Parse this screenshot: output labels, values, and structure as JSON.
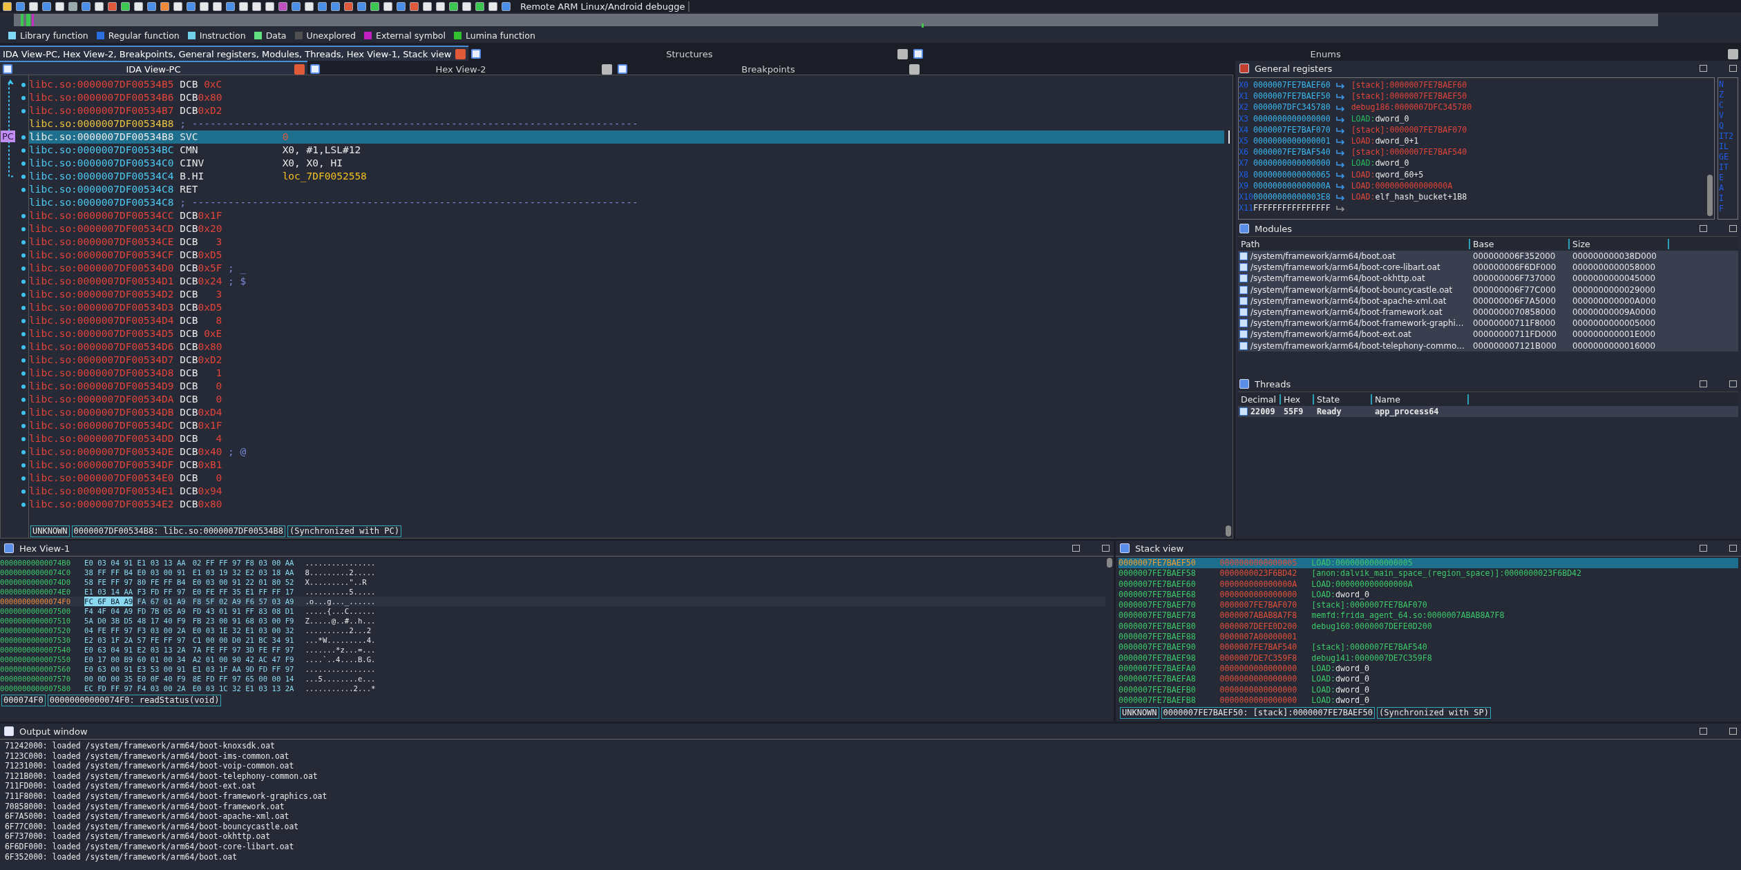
{
  "toolbar": {
    "debugger_name": "Remote ARM Linux/Android debugge"
  },
  "legend": [
    {
      "label": "Library function",
      "color": "#80d8f8"
    },
    {
      "label": "Regular function",
      "color": "#2a6fe0"
    },
    {
      "label": "Instruction",
      "color": "#70d0e8"
    },
    {
      "label": "Data",
      "color": "#60e080"
    },
    {
      "label": "Unexplored",
      "color": "#505050"
    },
    {
      "label": "External symbol",
      "color": "#c020c0"
    },
    {
      "label": "Lumina function",
      "color": "#30c030"
    }
  ],
  "main_tabs": [
    {
      "label": "IDA View-PC, Hex View-2, Breakpoints, General registers, Modules, Threads, Hex View-1, Stack view",
      "selected": true
    },
    {
      "label": "Structures",
      "selected": false
    },
    {
      "label": "Enums",
      "selected": false
    }
  ],
  "view_tabs": [
    {
      "label": "IDA View-PC",
      "selected": true
    },
    {
      "label": "Hex View-2",
      "selected": false
    },
    {
      "label": "Breakpoints",
      "selected": false
    }
  ],
  "disassembly": {
    "pc_marker": "PC",
    "lines": [
      {
        "kind": "data",
        "address": "libc.so:0000007DF00534B5",
        "mnemonic": "DCB",
        "operand": "0xC",
        "selected": false
      },
      {
        "kind": "data",
        "address": "libc.so:0000007DF00534B6",
        "mnemonic": "DCB",
        "operand": "0x80",
        "selected": false
      },
      {
        "kind": "data",
        "address": "libc.so:0000007DF00534B7",
        "mnemonic": "DCB",
        "operand": "0xD2",
        "selected": false
      },
      {
        "kind": "separator",
        "address": "libc.so:0000007DF00534B8",
        "comment": "; --------------------------------------------------------------------------",
        "selected": false
      },
      {
        "kind": "code",
        "address": "libc.so:0000007DF00534B8",
        "mnemonic": "SVC",
        "operand": "0",
        "operand_is_number": true,
        "operand_is_label": false,
        "selected": true
      },
      {
        "kind": "code",
        "address": "libc.so:0000007DF00534BC",
        "mnemonic": "CMN",
        "operand": "X0, #1,LSL#12",
        "operand_is_number": false,
        "operand_is_label": false,
        "selected": false
      },
      {
        "kind": "code",
        "address": "libc.so:0000007DF00534C0",
        "mnemonic": "CINV",
        "operand": "X0, X0, HI",
        "operand_is_number": false,
        "operand_is_label": false,
        "selected": false
      },
      {
        "kind": "code",
        "address": "libc.so:0000007DF00534C4",
        "mnemonic": "B.HI",
        "operand": "loc_7DF0052558",
        "operand_is_number": false,
        "operand_is_label": true,
        "selected": false
      },
      {
        "kind": "code",
        "address": "libc.so:0000007DF00534C8",
        "mnemonic": "RET",
        "selected": false
      },
      {
        "kind": "separator",
        "address": "libc.so:0000007DF00534C8",
        "comment": "; --------------------------------------------------------------------------",
        "selected": false
      },
      {
        "kind": "data",
        "address": "libc.so:0000007DF00534CC",
        "mnemonic": "DCB",
        "operand": "0x1F",
        "selected": false
      },
      {
        "kind": "data",
        "address": "libc.so:0000007DF00534CD",
        "mnemonic": "DCB",
        "operand": "0x20",
        "selected": false
      },
      {
        "kind": "data",
        "address": "libc.so:0000007DF00534CE",
        "mnemonic": "DCB",
        "operand": "3",
        "selected": false
      },
      {
        "kind": "data",
        "address": "libc.so:0000007DF00534CF",
        "mnemonic": "DCB",
        "operand": "0xD5",
        "selected": false
      },
      {
        "kind": "data",
        "address": "libc.so:0000007DF00534D0",
        "mnemonic": "DCB",
        "operand": "0x5F",
        "comment": "; _",
        "selected": false
      },
      {
        "kind": "data",
        "address": "libc.so:0000007DF00534D1",
        "mnemonic": "DCB",
        "operand": "0x24",
        "comment": "; $",
        "selected": false
      },
      {
        "kind": "data",
        "address": "libc.so:0000007DF00534D2",
        "mnemonic": "DCB",
        "operand": "3",
        "selected": false
      },
      {
        "kind": "data",
        "address": "libc.so:0000007DF00534D3",
        "mnemonic": "DCB",
        "operand": "0xD5",
        "selected": false
      },
      {
        "kind": "data",
        "address": "libc.so:0000007DF00534D4",
        "mnemonic": "DCB",
        "operand": "8",
        "selected": false
      },
      {
        "kind": "data",
        "address": "libc.so:0000007DF00534D5",
        "mnemonic": "DCB",
        "operand": "0xE",
        "selected": false
      },
      {
        "kind": "data",
        "address": "libc.so:0000007DF00534D6",
        "mnemonic": "DCB",
        "operand": "0x80",
        "selected": false
      },
      {
        "kind": "data",
        "address": "libc.so:0000007DF00534D7",
        "mnemonic": "DCB",
        "operand": "0xD2",
        "selected": false
      },
      {
        "kind": "data",
        "address": "libc.so:0000007DF00534D8",
        "mnemonic": "DCB",
        "operand": "1",
        "selected": false
      },
      {
        "kind": "data",
        "address": "libc.so:0000007DF00534D9",
        "mnemonic": "DCB",
        "operand": "0",
        "selected": false
      },
      {
        "kind": "data",
        "address": "libc.so:0000007DF00534DA",
        "mnemonic": "DCB",
        "operand": "0",
        "selected": false
      },
      {
        "kind": "data",
        "address": "libc.so:0000007DF00534DB",
        "mnemonic": "DCB",
        "operand": "0xD4",
        "selected": false
      },
      {
        "kind": "data",
        "address": "libc.so:0000007DF00534DC",
        "mnemonic": "DCB",
        "operand": "0x1F",
        "selected": false
      },
      {
        "kind": "data",
        "address": "libc.so:0000007DF00534DD",
        "mnemonic": "DCB",
        "operand": "4",
        "selected": false
      },
      {
        "kind": "data",
        "address": "libc.so:0000007DF00534DE",
        "mnemonic": "DCB",
        "operand": "0x40",
        "comment": "; @",
        "selected": false
      },
      {
        "kind": "data",
        "address": "libc.so:0000007DF00534DF",
        "mnemonic": "DCB",
        "operand": "0xB1",
        "selected": false
      },
      {
        "kind": "data",
        "address": "libc.so:0000007DF00534E0",
        "mnemonic": "DCB",
        "operand": "0",
        "selected": false
      },
      {
        "kind": "data",
        "address": "libc.so:0000007DF00534E1",
        "mnemonic": "DCB",
        "operand": "0x94",
        "selected": false
      },
      {
        "kind": "data",
        "address": "libc.so:0000007DF00534E2",
        "mnemonic": "DCB",
        "operand": "0x80",
        "selected": false
      }
    ],
    "status": [
      "UNKNOWN",
      "0000007DF00534B8: libc.so:0000007DF00534B8",
      "(Synchronized with PC)"
    ]
  },
  "registers": {
    "title": "General registers",
    "rows": [
      {
        "name": "X0",
        "value": "0000007FE7BAEF60",
        "valid_pointer": true,
        "segment": "[stack]:",
        "code_segment": false,
        "symbol": "0000007FE7BAEF60",
        "named_symbol": false
      },
      {
        "name": "X1",
        "value": "0000007FE7BAEF50",
        "valid_pointer": true,
        "segment": "[stack]:",
        "code_segment": false,
        "symbol": "0000007FE7BAEF50",
        "named_symbol": false
      },
      {
        "name": "X2",
        "value": "0000007DFC345780",
        "valid_pointer": true,
        "segment": "debug186:",
        "code_segment": false,
        "symbol": "0000007DFC345780",
        "named_symbol": false
      },
      {
        "name": "X3",
        "value": "0000000000000000",
        "valid_pointer": true,
        "segment": "LOAD:",
        "code_segment": true,
        "symbol": "dword_0",
        "named_symbol": true
      },
      {
        "name": "X4",
        "value": "0000007FE7BAF070",
        "valid_pointer": true,
        "segment": "[stack]:",
        "code_segment": false,
        "symbol": "0000007FE7BAF070",
        "named_symbol": false
      },
      {
        "name": "X5",
        "value": "0000000000000001",
        "valid_pointer": true,
        "segment": "LOAD:",
        "code_segment": false,
        "symbol": "dword_0+1",
        "named_symbol": true
      },
      {
        "name": "X6",
        "value": "0000007FE7BAF540",
        "valid_pointer": true,
        "segment": "[stack]:",
        "code_segment": false,
        "symbol": "0000007FE7BAF540",
        "named_symbol": false
      },
      {
        "name": "X7",
        "value": "0000000000000000",
        "valid_pointer": true,
        "segment": "LOAD:",
        "code_segment": true,
        "symbol": "dword_0",
        "named_symbol": true
      },
      {
        "name": "X8",
        "value": "0000000000000065",
        "valid_pointer": true,
        "segment": "LOAD:",
        "code_segment": false,
        "symbol": "qword_60+5",
        "named_symbol": true
      },
      {
        "name": "X9",
        "value": "000000000000000A",
        "valid_pointer": true,
        "segment": "LOAD:",
        "code_segment": false,
        "symbol": "000000000000000A",
        "named_symbol": false
      },
      {
        "name": "X10",
        "value": "00000000000003E8",
        "valid_pointer": true,
        "segment": "LOAD:",
        "code_segment": false,
        "symbol": "elf_hash_bucket+1B8",
        "named_symbol": true
      },
      {
        "name": "X11",
        "value": "FFFFFFFFFFFFFFFF",
        "valid_pointer": false
      }
    ],
    "flags": [
      "N",
      "Z",
      "C",
      "V",
      "Q",
      "IT2",
      "IL",
      "GE",
      "IT",
      "E",
      "A",
      "I",
      "F"
    ]
  },
  "modules": {
    "title": "Modules",
    "columns": [
      "Path",
      "Base",
      "Size"
    ],
    "rows": [
      {
        "path": "/system/framework/arm64/boot.oat",
        "base": "000000006F352000",
        "size": "000000000038D000"
      },
      {
        "path": "/system/framework/arm64/boot-core-libart.oat",
        "base": "000000006F6DF000",
        "size": "0000000000058000"
      },
      {
        "path": "/system/framework/arm64/boot-okhttp.oat",
        "base": "000000006F737000",
        "size": "0000000000045000"
      },
      {
        "path": "/system/framework/arm64/boot-bouncycastle.oat",
        "base": "000000006F77C000",
        "size": "0000000000029000"
      },
      {
        "path": "/system/framework/arm64/boot-apache-xml.oat",
        "base": "000000006F7A5000",
        "size": "000000000000A000"
      },
      {
        "path": "/system/framework/arm64/boot-framework.oat",
        "base": "0000000070858000",
        "size": "00000000009A0000"
      },
      {
        "path": "/system/framework/arm64/boot-framework-graphi…",
        "base": "00000000711F8000",
        "size": "0000000000005000"
      },
      {
        "path": "/system/framework/arm64/boot-ext.oat",
        "base": "00000000711FD000",
        "size": "000000000001E000"
      },
      {
        "path": "/system/framework/arm64/boot-telephony-commo…",
        "base": "000000007121B000",
        "size": "0000000000016000"
      }
    ]
  },
  "threads": {
    "title": "Threads",
    "columns": [
      "Decimal",
      "Hex",
      "State",
      "Name"
    ],
    "rows": [
      {
        "decimal": "22009",
        "hex": "55F9",
        "state": "Ready",
        "name": "app_process64"
      }
    ]
  },
  "hex_view": {
    "title": "Hex View-1",
    "rows": [
      {
        "address": "00000000000074B0",
        "bytes_left": "E0 03 04 91 E1 03 13 AA",
        "bytes_right": "02 FF FF 97 F8 03 00 AA",
        "ascii": "................",
        "current": false
      },
      {
        "address": "00000000000074C0",
        "bytes_left": "38 FF FF B4 E0 03 00 91",
        "bytes_right": "E1 03 19 32 E2 03 18 AA",
        "ascii": "8.........2.....",
        "current": false
      },
      {
        "address": "00000000000074D0",
        "bytes_left": "58 FE FF 97 80 FE FF B4",
        "bytes_right": "E0 03 00 91 22 01 80 52",
        "ascii": "X.........\"..R",
        "current": false
      },
      {
        "address": "00000000000074E0",
        "bytes_left": "E1 03 14 AA F3 FD FF 97",
        "bytes_right": "E0 FE FF 35 E1 FF FF 17",
        "ascii": "..........5.....",
        "current": false
      },
      {
        "address": "00000000000074F0",
        "selection": "FC 6F BA A9",
        "bytes_left": "FA 67 01 A9",
        "bytes_right": "F8 5F 02 A9 F6 57 03 A9",
        "ascii": ".o...g..._......",
        "current": true
      },
      {
        "address": "0000000000007500",
        "bytes_left": "F4 4F 04 A9 FD 7B 05 A9",
        "bytes_right": "FD 43 01 91 FF 83 08 D1",
        "ascii": ".....{...C......",
        "current": false
      },
      {
        "address": "0000000000007510",
        "bytes_left": "5A D0 3B D5 48 17 40 F9",
        "bytes_right": "FB 23 00 91 68 03 00 F9",
        "ascii": "Z.....@..#..h...",
        "current": false
      },
      {
        "address": "0000000000007520",
        "bytes_left": "04 FE FF 97 F3 03 00 2A",
        "bytes_right": "E0 03 1E 32 E1 03 00 32",
        "ascii": "..........2...2",
        "current": false
      },
      {
        "address": "0000000000007530",
        "bytes_left": "E2 03 1F 2A 57 FE FF 97",
        "bytes_right": "C1 00 00 D0 21 BC 34 91",
        "ascii": "...*W.........4.",
        "current": false
      },
      {
        "address": "0000000000007540",
        "bytes_left": "E0 63 04 91 E2 03 13 2A",
        "bytes_right": "7A FE FF 97 3D FE FF 97",
        "ascii": ".......*z...=...",
        "current": false
      },
      {
        "address": "0000000000007550",
        "bytes_left": "E0 17 00 B9 60 01 00 34",
        "bytes_right": "A2 01 00 90 42 AC 47 F9",
        "ascii": "....`..4....B.G.",
        "current": false
      },
      {
        "address": "0000000000007560",
        "bytes_left": "E0 63 00 91 E3 53 00 91",
        "bytes_right": "E1 03 1F AA 9D FD FF 97",
        "ascii": "................",
        "current": false
      },
      {
        "address": "0000000000007570",
        "bytes_left": "00 0D 00 35 E0 0F 40 F9",
        "bytes_right": "8E FD FF 97 65 00 00 14",
        "ascii": "...5........e...",
        "current": false
      },
      {
        "address": "0000000000007580",
        "bytes_left": "EC FD FF 97 F4 03 00 2A",
        "bytes_right": "E0 03 1C 32 E1 03 13 2A",
        "ascii": "...........2...*",
        "current": false
      }
    ],
    "status": [
      "000074F0",
      "00000000000074F0: readStatus(void)"
    ]
  },
  "stack_view": {
    "title": "Stack view",
    "rows": [
      {
        "address": "0000007FE7BAEF50",
        "value": "0000000000000005",
        "segment": "LOAD:",
        "symbol": "0000000000000005",
        "named_symbol": false,
        "selected": true
      },
      {
        "address": "0000007FE7BAEF58",
        "value": "0000000023F6BD42",
        "segment": "[anon:dalvik_main_space_(region_space)]:",
        "symbol": "0000000023F6BD42",
        "named_symbol": false,
        "selected": false
      },
      {
        "address": "0000007FE7BAEF60",
        "value": "000000000000000A",
        "segment": "LOAD:",
        "symbol": "000000000000000A",
        "named_symbol": false,
        "selected": false
      },
      {
        "address": "0000007FE7BAEF68",
        "value": "0000000000000000",
        "segment": "LOAD:",
        "symbol": "dword_0",
        "named_symbol": true,
        "selected": false
      },
      {
        "address": "0000007FE7BAEF70",
        "value": "0000007FE7BAF070",
        "segment": "[stack]:",
        "symbol": "0000007FE7BAF070",
        "named_symbol": false,
        "selected": false
      },
      {
        "address": "0000007FE7BAEF78",
        "value": "0000007ABAB8A7F8",
        "segment": "memfd:frida_agent_64.so:",
        "symbol": "0000007ABAB8A7F8",
        "named_symbol": false,
        "selected": false
      },
      {
        "address": "0000007FE7BAEF80",
        "value": "0000007DEFE0D200",
        "segment": "debug160:",
        "symbol": "0000007DEFE0D200",
        "named_symbol": false,
        "selected": false
      },
      {
        "address": "0000007FE7BAEF88",
        "value": "0000007A00000001",
        "selected": false
      },
      {
        "address": "0000007FE7BAEF90",
        "value": "0000007FE7BAF540",
        "segment": "[stack]:",
        "symbol": "0000007FE7BAF540",
        "named_symbol": false,
        "selected": false
      },
      {
        "address": "0000007FE7BAEF98",
        "value": "0000007DE7C359F8",
        "segment": "debug141:",
        "symbol": "0000007DE7C359F8",
        "named_symbol": false,
        "selected": false
      },
      {
        "address": "0000007FE7BAEFA0",
        "value": "0000000000000000",
        "segment": "LOAD:",
        "symbol": "dword_0",
        "named_symbol": true,
        "selected": false
      },
      {
        "address": "0000007FE7BAEFA8",
        "value": "0000000000000000",
        "segment": "LOAD:",
        "symbol": "dword_0",
        "named_symbol": true,
        "selected": false
      },
      {
        "address": "0000007FE7BAEFB0",
        "value": "0000000000000000",
        "segment": "LOAD:",
        "symbol": "dword_0",
        "named_symbol": true,
        "selected": false
      },
      {
        "address": "0000007FE7BAEFB8",
        "value": "0000000000000000",
        "segment": "LOAD:",
        "symbol": "dword_0",
        "named_symbol": true,
        "selected": false
      }
    ],
    "status": [
      "UNKNOWN",
      "0000007FE7BAEF50: [stack]:0000007FE7BAEF50",
      "(Synchronized with SP)"
    ]
  },
  "output": {
    "title": "Output window",
    "lines": [
      "71242000: loaded /system/framework/arm64/boot-knoxsdk.oat",
      "7123C000: loaded /system/framework/arm64/boot-ims-common.oat",
      "71231000: loaded /system/framework/arm64/boot-voip-common.oat",
      "7121B000: loaded /system/framework/arm64/boot-telephony-common.oat",
      "711FD000: loaded /system/framework/arm64/boot-ext.oat",
      "711F8000: loaded /system/framework/arm64/boot-framework-graphics.oat",
      "70858000: loaded /system/framework/arm64/boot-framework.oat",
      "6F7A5000: loaded /system/framework/arm64/boot-apache-xml.oat",
      "6F77C000: loaded /system/framework/arm64/boot-bouncycastle.oat",
      "6F737000: loaded /system/framework/arm64/boot-okhttp.oat",
      "6F6DF000: loaded /system/framework/arm64/boot-core-libart.oat",
      "6F352000: loaded /system/framework/arm64/boot.oat"
    ]
  }
}
